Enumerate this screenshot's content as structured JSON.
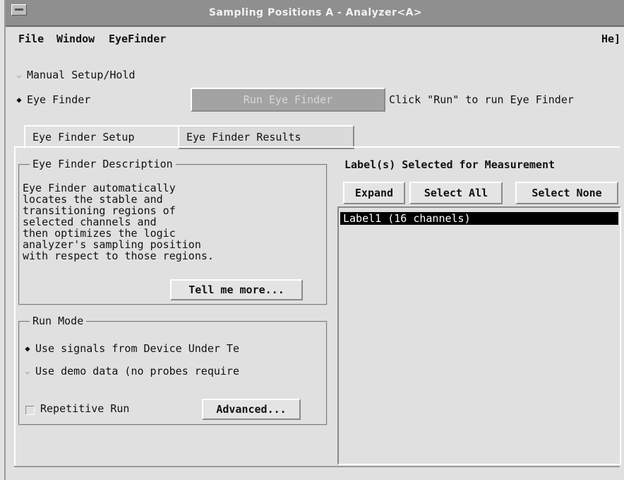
{
  "window": {
    "title": "Sampling Positions A - Analyzer<A>"
  },
  "menubar": {
    "file": "File",
    "window": "Window",
    "eyefinder": "EyeFinder",
    "help": "He]"
  },
  "mode": {
    "manual": "Manual Setup/Hold",
    "eye_finder": "Eye Finder",
    "selected": "eye_finder"
  },
  "run_button": "Run Eye Finder",
  "status": "Click \"Run\" to run Eye Finder",
  "tabs": [
    {
      "label": "Eye Finder Setup",
      "active": true
    },
    {
      "label": "Eye Finder Results",
      "active": false
    }
  ],
  "description": {
    "title": "Eye Finder Description",
    "lines": [
      "Eye Finder automatically",
      "locates the stable and",
      "transitioning regions of",
      "selected channels and",
      "then optimizes the logic",
      "analyzer's sampling position",
      "with respect to those regions."
    ],
    "tell_more": "Tell me more..."
  },
  "run_mode": {
    "title": "Run Mode",
    "use_signals": "Use signals from Device Under Te",
    "use_demo": "Use demo data (no probes require",
    "repetitive": "Repetitive Run",
    "advanced": "Advanced..."
  },
  "labels": {
    "title": "Label(s) Selected for Measurement",
    "expand": "Expand",
    "select_all": "Select All",
    "select_none": "Select None",
    "items": [
      "Label1 (16 channels)"
    ]
  }
}
